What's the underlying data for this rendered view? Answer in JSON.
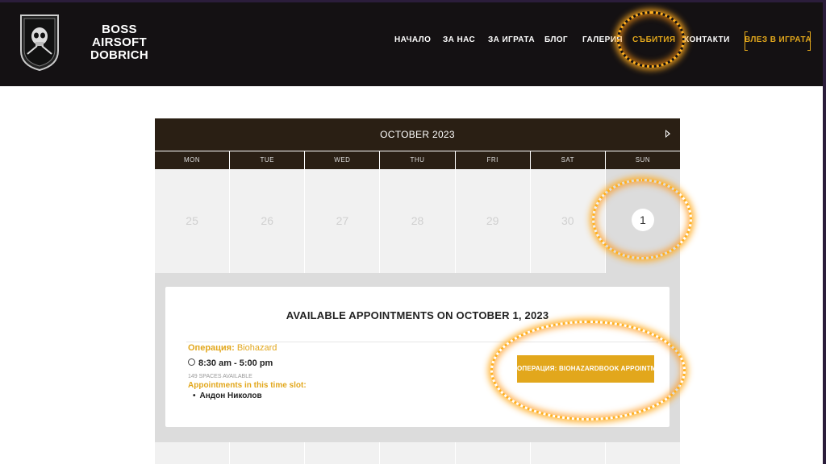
{
  "brand": {
    "line1": "BOSS",
    "line2": "AIRSOFT DOBRICH"
  },
  "nav": [
    {
      "label": "НАЧАЛО"
    },
    {
      "label": "ЗА НАС"
    },
    {
      "label": "ЗА ИГРАТА"
    },
    {
      "label": "БЛОГ"
    },
    {
      "label": "ГАЛЕРИЯ"
    },
    {
      "label": "СЪБИТИЯ",
      "active": true
    },
    {
      "label": "КОНТАКТИ"
    }
  ],
  "login_label": "ВЛЕЗ В ИГРАТА",
  "calendar": {
    "month": "OCTOBER 2023",
    "weekdays": [
      "MON",
      "TUE",
      "WED",
      "THU",
      "FRI",
      "SAT",
      "SUN"
    ],
    "days": [
      "25",
      "26",
      "27",
      "28",
      "29",
      "30",
      "1"
    ]
  },
  "appointments": {
    "title": "AVAILABLE APPOINTMENTS ON OCTOBER 1, 2023",
    "operation_prefix": "Операция:",
    "operation_name": "Biohazard",
    "time": "8:30 am - 5:00 pm",
    "spaces": "149 SPACES AVAILABLE",
    "slot_label": "Appointments in this time slot:",
    "attendee": "Андон Николов",
    "book_label": "ОПЕРАЦИЯ: BIOHAZARDBOOK APPOINTMENT"
  },
  "colors": {
    "accent": "#e2a71c",
    "header_bg": "#141113",
    "calendar_header": "#2a1f14"
  }
}
